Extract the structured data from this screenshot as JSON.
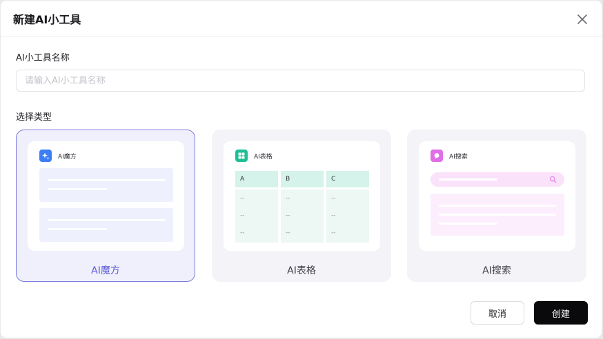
{
  "dialog": {
    "title": "新建AI小工具",
    "close_icon": "close-icon"
  },
  "name_field": {
    "label": "AI小工具名称",
    "value": "",
    "placeholder": "请输入AI小工具名称"
  },
  "type_section": {
    "label": "选择类型",
    "selected": "magic",
    "cards": {
      "magic": {
        "label": "AI魔方",
        "preview_title": "AI魔方",
        "icon": "sparkle-icon",
        "icon_color": "#3d7ef7"
      },
      "table": {
        "label": "AI表格",
        "preview_title": "AI表格",
        "icon": "grid-icon",
        "icon_color": "#1fbf95",
        "columns": [
          {
            "header": "A",
            "cells": [
              "--",
              "--",
              "--"
            ]
          },
          {
            "header": "B",
            "cells": [
              "--",
              "--",
              "--"
            ]
          },
          {
            "header": "C",
            "cells": [
              "--",
              "--",
              "--"
            ]
          }
        ]
      },
      "search": {
        "label": "AI搜索",
        "preview_title": "AI搜索",
        "icon": "search-bubble-icon",
        "icon_color": "#e06fe6"
      }
    }
  },
  "footer": {
    "cancel_label": "取消",
    "create_label": "创建"
  },
  "colors": {
    "accent": "#5b58d6",
    "primary_button": "#0a0a0c"
  }
}
